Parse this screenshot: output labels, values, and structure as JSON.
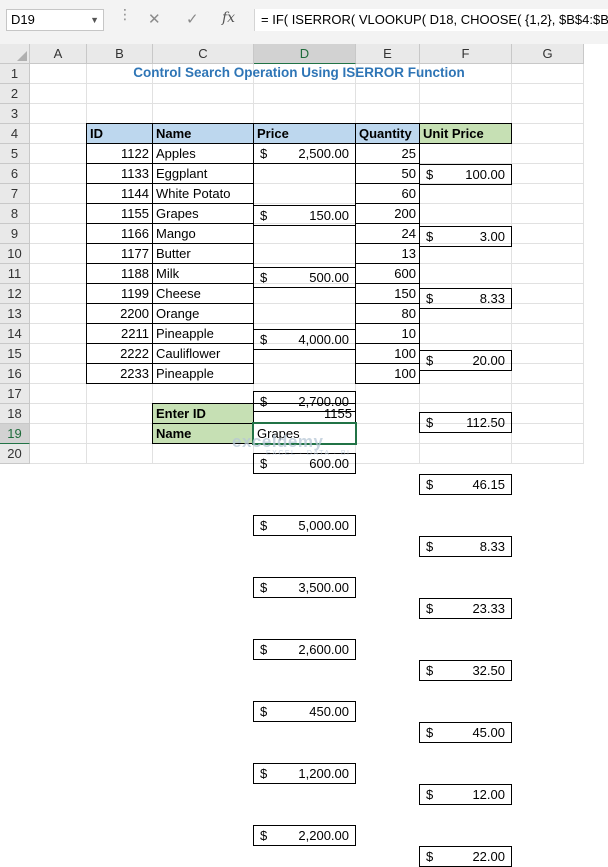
{
  "formula_bar": {
    "name_box": "D19",
    "formula": "= IF( ISERROR( VLOOKUP( D18, CHOOSE( {1,2}, $B$4:$B$15"
  },
  "columns": [
    "A",
    "B",
    "C",
    "D",
    "E",
    "F",
    "G"
  ],
  "rows": [
    "1",
    "2",
    "3",
    "4",
    "5",
    "6",
    "7",
    "8",
    "9",
    "10",
    "11",
    "12",
    "13",
    "14",
    "15",
    "16",
    "17",
    "18",
    "19",
    "20"
  ],
  "selected_cell": {
    "column": "D",
    "row": "19"
  },
  "title": "Control Search Operation Using ISERROR Function",
  "table": {
    "headers": [
      "ID",
      "Name",
      "Price",
      "Quantity",
      "Unit Price"
    ],
    "currency_symbol": "$",
    "rows": [
      {
        "id": "1122",
        "name": "Apples",
        "price": "2,500.00",
        "qty": "25",
        "unit": "100.00"
      },
      {
        "id": "1133",
        "name": "Eggplant",
        "price": "150.00",
        "qty": "50",
        "unit": "3.00"
      },
      {
        "id": "1144",
        "name": "White Potato",
        "price": "500.00",
        "qty": "60",
        "unit": "8.33"
      },
      {
        "id": "1155",
        "name": "Grapes",
        "price": "4,000.00",
        "qty": "200",
        "unit": "20.00"
      },
      {
        "id": "1166",
        "name": "Mango",
        "price": "2,700.00",
        "qty": "24",
        "unit": "112.50"
      },
      {
        "id": "1177",
        "name": "Butter",
        "price": "600.00",
        "qty": "13",
        "unit": "46.15"
      },
      {
        "id": "1188",
        "name": "Milk",
        "price": "5,000.00",
        "qty": "600",
        "unit": "8.33"
      },
      {
        "id": "1199",
        "name": "Cheese",
        "price": "3,500.00",
        "qty": "150",
        "unit": "23.33"
      },
      {
        "id": "2200",
        "name": "Orange",
        "price": "2,600.00",
        "qty": "80",
        "unit": "32.50"
      },
      {
        "id": "2211",
        "name": "Pineapple",
        "price": "450.00",
        "qty": "10",
        "unit": "45.00"
      },
      {
        "id": "2222",
        "name": "Cauliflower",
        "price": "1,200.00",
        "qty": "100",
        "unit": "12.00"
      },
      {
        "id": "2233",
        "name": "Pineapple",
        "price": "2,200.00",
        "qty": "100",
        "unit": "22.00"
      }
    ]
  },
  "lookup": {
    "enter_id_label": "Enter ID",
    "enter_id_value": "1155",
    "name_label": "Name",
    "name_value": "Grapes"
  },
  "watermark": {
    "name": "exceldemy",
    "tagline": "EXCEL · DATA · BI"
  },
  "colors": {
    "title": "#2e75b6",
    "header_blue": "#bdd7ee",
    "header_green": "#c6e0b4",
    "selection": "#217346"
  }
}
